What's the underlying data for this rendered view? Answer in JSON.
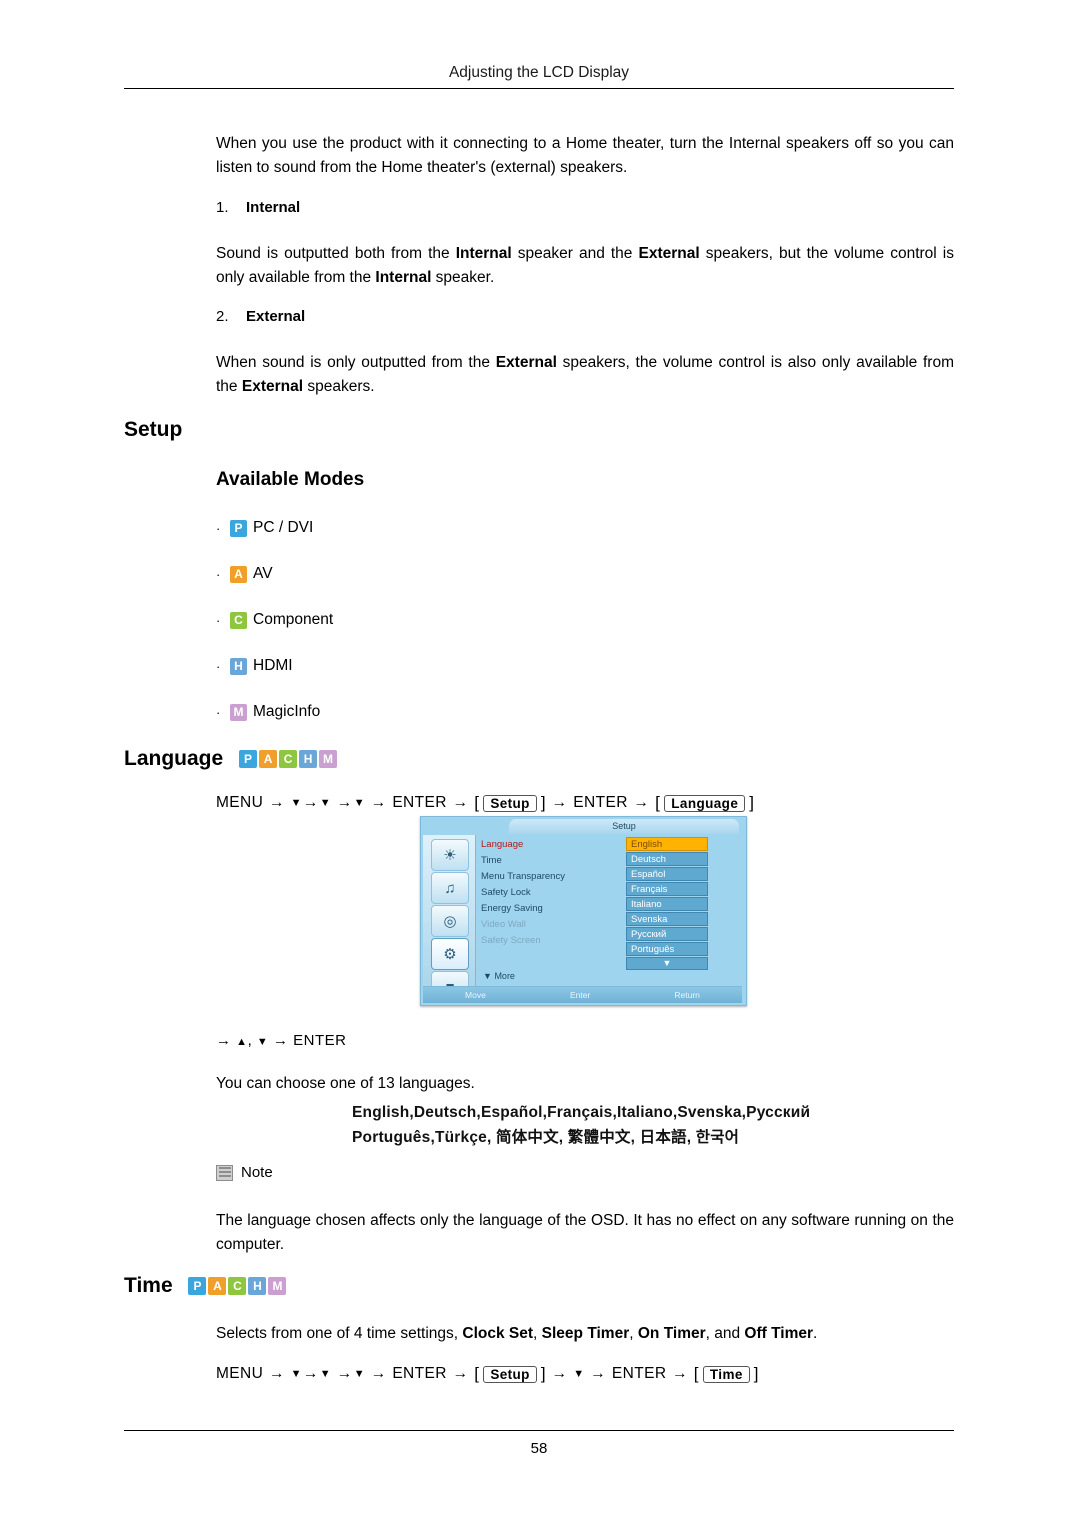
{
  "header": {
    "title": "Adjusting the LCD Display"
  },
  "footer": {
    "page_number": "58"
  },
  "intro": {
    "paragraph": "When you use the product with it connecting to a Home theater, turn the Internal speakers off so you can listen to sound from the Home theater's (external) speakers."
  },
  "items": [
    {
      "number": "1.",
      "label": "Internal",
      "body_1": "Sound is outputted both from the ",
      "bold_1": "Internal",
      "body_2": " speaker and the ",
      "bold_2": "External",
      "body_3": " speakers, but the volume control is only available from the ",
      "bold_3": "Internal",
      "body_4": " speaker."
    },
    {
      "number": "2.",
      "label": "External",
      "body_1": "When sound is only outputted from the ",
      "bold_1": "External",
      "body_2": " speakers, the volume control is also only available from the ",
      "bold_2": "External",
      "body_3": " speakers."
    }
  ],
  "setup": {
    "heading": "Setup",
    "available_modes_heading": "Available Modes",
    "modes": [
      {
        "badge": "P",
        "label": "PC / DVI",
        "color": "#3aa6dd"
      },
      {
        "badge": "A",
        "label": "AV",
        "color": "#f0a02a"
      },
      {
        "badge": "C",
        "label": "Component",
        "color": "#8ec63f"
      },
      {
        "badge": "H",
        "label": "HDMI",
        "color": "#6aa7d8"
      },
      {
        "badge": "M",
        "label": "MagicInfo",
        "color": "#c9a0cf"
      }
    ]
  },
  "language": {
    "heading": "Language",
    "badges": [
      "P",
      "A",
      "C",
      "H",
      "M"
    ],
    "menu_path": {
      "start": "MENU",
      "enter_1": "ENTER",
      "box_1": "Setup",
      "enter_2": "ENTER",
      "box_2": "Language"
    },
    "second_path": ", ",
    "second_path_enter": "ENTER",
    "description": "You can choose one of 13 languages.",
    "languages_line_1": "English,Deutsch,Español,Français,Italiano,Svenska,Русский",
    "languages_line_2": "Português,Türkçe, 简体中文,  繁體中文, 日本語, 한국어",
    "note_label": "Note",
    "note_text": "The language chosen affects only the language of the OSD. It has no effect on any software running on the computer."
  },
  "osd": {
    "title": "Setup",
    "menu_items": [
      {
        "label": "Language",
        "state": "highlight"
      },
      {
        "label": "Time",
        "state": "normal"
      },
      {
        "label": "Menu Transparency",
        "state": "normal"
      },
      {
        "label": "Safety Lock",
        "state": "normal"
      },
      {
        "label": "Energy Saving",
        "state": "normal"
      },
      {
        "label": "Video Wall",
        "state": "dim"
      },
      {
        "label": "Safety Screen",
        "state": "dim"
      }
    ],
    "more_label": "More",
    "values": [
      {
        "label": "English",
        "selected": true
      },
      {
        "label": "Deutsch",
        "selected": false
      },
      {
        "label": "Español",
        "selected": false
      },
      {
        "label": "Français",
        "selected": false
      },
      {
        "label": "Italiano",
        "selected": false
      },
      {
        "label": "Svenska",
        "selected": false
      },
      {
        "label": "Русский",
        "selected": false
      },
      {
        "label": "Português",
        "selected": false
      }
    ],
    "footer_hints": [
      "Move",
      "Enter",
      "Return"
    ],
    "sidebar_icons": [
      "picture-icon",
      "sound-icon",
      "input-icon",
      "setup-icon",
      "multi-control-icon"
    ]
  },
  "time": {
    "heading": "Time",
    "badges": [
      "P",
      "A",
      "C",
      "H",
      "M"
    ],
    "description_pre": "Selects from one of 4 time settings, ",
    "b1": "Clock Set",
    "sep1": ", ",
    "b2": "Sleep Timer",
    "sep2": ", ",
    "b3": "On Timer",
    "sep3": ", and ",
    "b4": "Off Timer",
    "end": ".",
    "menu_path": {
      "start": "MENU",
      "enter_1": "ENTER",
      "box_1": "Setup",
      "enter_2": "ENTER",
      "box_2": "Time"
    }
  }
}
